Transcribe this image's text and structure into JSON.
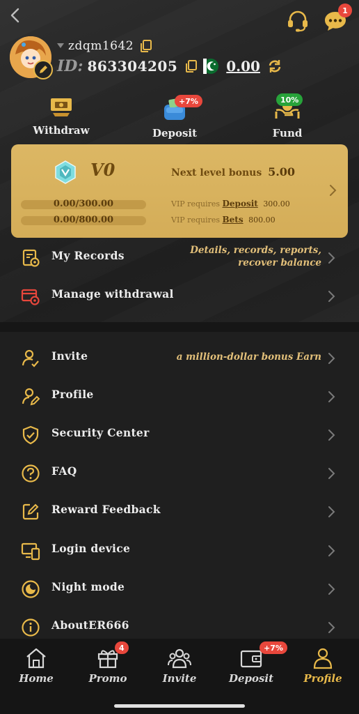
{
  "user": {
    "username": "zdqm1642",
    "id_label": "ID:",
    "id_value": "863304205",
    "balance": "0.00"
  },
  "top_bar": {
    "chat_badge": "1"
  },
  "quick_actions": [
    {
      "label": "Withdraw",
      "icon": "withdraw-icon"
    },
    {
      "label": "Deposit",
      "icon": "deposit-icon",
      "badge": "+7%"
    },
    {
      "label": "Fund",
      "icon": "fund-icon",
      "badge": "10%"
    }
  ],
  "vip": {
    "level": "V0",
    "next_level_label": "Next level bonus",
    "next_level_value": "5.00",
    "deposit_progress": "0.00/300.00",
    "bets_progress": "0.00/800.00",
    "req_prefix": "VIP requires",
    "deposit_label": "Deposit",
    "deposit_value": "300.00",
    "bets_label": "Bets",
    "bets_value": "800.00"
  },
  "records": {
    "label": "My Records",
    "hint_line1": "Details, records, reports,",
    "hint_line2": "recover balance"
  },
  "manage_withdrawal": {
    "label": "Manage withdrawal"
  },
  "menu": {
    "invite": {
      "label": "Invite",
      "hint": "a million-dollar bonus Earn"
    },
    "profile": {
      "label": "Profile"
    },
    "security": {
      "label": "Security Center"
    },
    "faq": {
      "label": "FAQ"
    },
    "reward": {
      "label": "Reward Feedback"
    },
    "login_device": {
      "label": "Login device"
    },
    "night_mode": {
      "label": "Night mode"
    },
    "about": {
      "label": "AboutER666"
    }
  },
  "bottom_nav": {
    "home": "Home",
    "promo": "Promo",
    "promo_badge": "4",
    "invite": "Invite",
    "deposit": "Deposit",
    "deposit_badge": "+7%",
    "profile": "Profile"
  },
  "colors": {
    "accent_gold": "#e8b94a",
    "vip_card": "#d4ad58",
    "badge_red": "#e8473c",
    "badge_green": "#27a33a"
  }
}
